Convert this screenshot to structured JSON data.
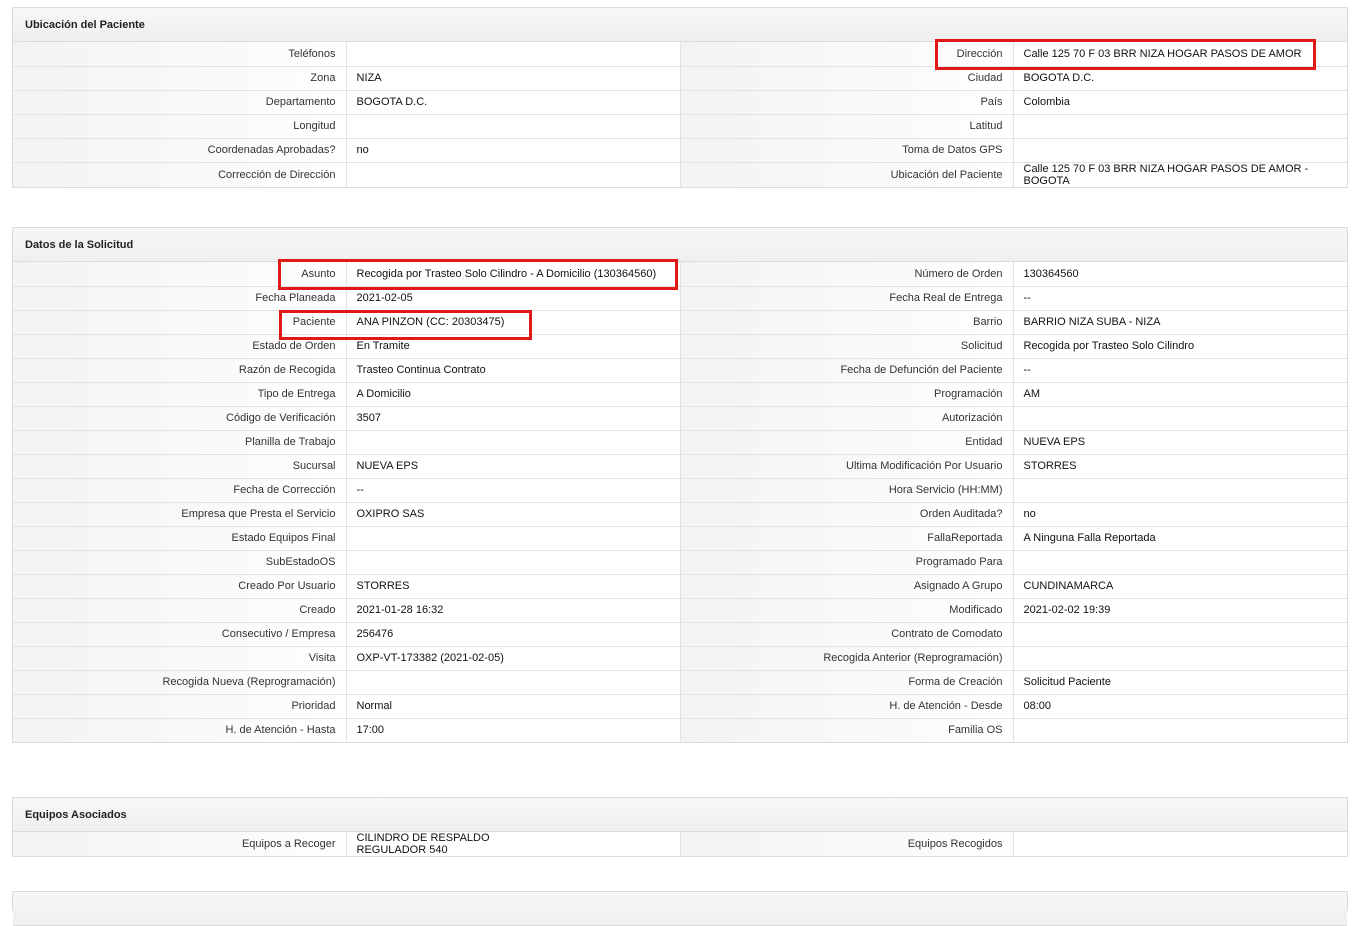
{
  "sections": [
    {
      "title": "Ubicación del Paciente",
      "rows": [
        [
          [
            "Teléfonos",
            ""
          ],
          [
            "Dirección",
            "Calle 125 70 F 03 BRR NIZA HOGAR PASOS DE AMOR"
          ]
        ],
        [
          [
            "Zona",
            "NIZA"
          ],
          [
            "Ciudad",
            "BOGOTA D.C."
          ]
        ],
        [
          [
            "Departamento",
            "BOGOTA D.C."
          ],
          [
            "País",
            "Colombia"
          ]
        ],
        [
          [
            "Longitud",
            ""
          ],
          [
            "Latitud",
            ""
          ]
        ],
        [
          [
            "Coordenadas Aprobadas?",
            " no"
          ],
          [
            "Toma de Datos GPS",
            ""
          ]
        ],
        [
          [
            "Corrección de Dirección",
            ""
          ],
          [
            "Ubicación del Paciente",
            "Calle 125 70 F 03 BRR NIZA HOGAR PASOS DE AMOR - BOGOTA"
          ]
        ]
      ]
    },
    {
      "title": "Datos de la Solicitud",
      "rows": [
        [
          [
            "Asunto",
            "Recogida por Trasteo Solo Cilindro - A Domicilio (130364560)"
          ],
          [
            "Número de Orden",
            "130364560"
          ]
        ],
        [
          [
            "Fecha Planeada",
            " 2021-02-05"
          ],
          [
            "Fecha Real de Entrega",
            "--"
          ]
        ],
        [
          [
            "Paciente",
            "ANA PINZON (CC: 20303475)"
          ],
          [
            "Barrio",
            "BARRIO NIZA SUBA - NIZA"
          ]
        ],
        [
          [
            "Estado de Orden",
            "En Tramite"
          ],
          [
            "Solicitud",
            "Recogida por Trasteo Solo Cilindro"
          ]
        ],
        [
          [
            "Razón de Recogida",
            "Trasteo Continua Contrato"
          ],
          [
            "Fecha de Defunción del Paciente",
            "--"
          ]
        ],
        [
          [
            "Tipo de Entrega",
            "A Domicilio"
          ],
          [
            "Programación",
            "AM"
          ]
        ],
        [
          [
            "Código de Verificación",
            "3507"
          ],
          [
            "Autorización",
            ""
          ]
        ],
        [
          [
            "Planilla de Trabajo",
            ""
          ],
          [
            "Entidad",
            "NUEVA EPS"
          ]
        ],
        [
          [
            "Sucursal",
            "NUEVA EPS"
          ],
          [
            "Ultima Modificación Por Usuario",
            "STORRES"
          ]
        ],
        [
          [
            "Fecha de Corrección",
            " --"
          ],
          [
            "Hora Servicio (HH:MM)",
            ""
          ]
        ],
        [
          [
            "Empresa que Presta el Servicio",
            "OXIPRO SAS"
          ],
          [
            "Orden Auditada?",
            " no"
          ]
        ],
        [
          [
            "Estado Equipos Final",
            ""
          ],
          [
            "FallaReportada",
            "A Ninguna Falla Reportada"
          ]
        ],
        [
          [
            "SubEstadoOS",
            ""
          ],
          [
            "Programado Para",
            ""
          ]
        ],
        [
          [
            "Creado Por Usuario",
            "STORRES"
          ],
          [
            "Asignado A Grupo",
            "CUNDINAMARCA"
          ]
        ],
        [
          [
            "Creado",
            "2021-01-28 16:32"
          ],
          [
            "Modificado",
            "2021-02-02 19:39"
          ]
        ],
        [
          [
            "Consecutivo / Empresa",
            "256476"
          ],
          [
            "Contrato de Comodato",
            ""
          ]
        ],
        [
          [
            "Visita",
            "OXP-VT-173382 (2021-02-05)"
          ],
          [
            "Recogida Anterior (Reprogramación)",
            ""
          ]
        ],
        [
          [
            "Recogida Nueva (Reprogramación)",
            ""
          ],
          [
            "Forma de Creación",
            "Solicitud Paciente"
          ]
        ],
        [
          [
            "Prioridad",
            "Normal"
          ],
          [
            "H. de Atención - Desde",
            "08:00"
          ]
        ],
        [
          [
            "H. de Atención - Hasta",
            "17:00"
          ],
          [
            "Familia OS",
            ""
          ]
        ]
      ]
    },
    {
      "title": "Equipos Asociados",
      "rows": [
        [
          [
            "Equipos a Recoger",
            "CILINDRO DE RESPALDO\nREGULADOR 540"
          ],
          [
            "Equipos Recogidos",
            ""
          ]
        ]
      ]
    },
    {
      "title": "",
      "rows": []
    }
  ],
  "colors": {
    "highlight": "#e01818",
    "border": "#dcdcdc",
    "header_bg": "#f2f2f2"
  }
}
